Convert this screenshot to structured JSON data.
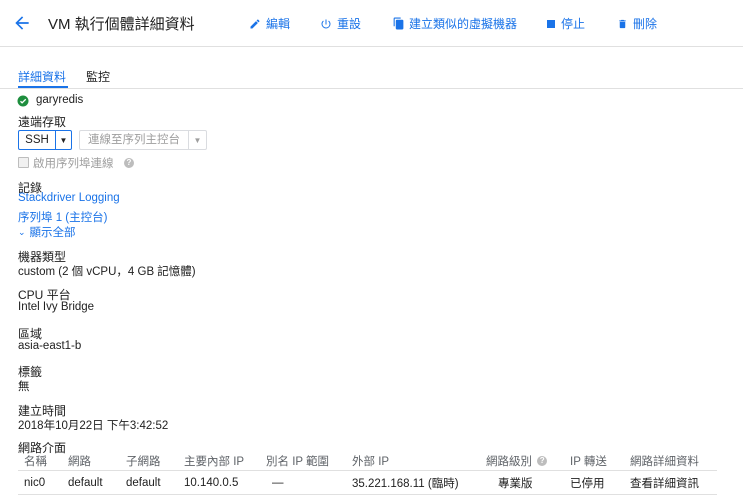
{
  "header": {
    "title": "VM 執行個體詳細資料",
    "actions": [
      {
        "label": "編輯",
        "icon": "pencil-icon"
      },
      {
        "label": "重設",
        "icon": "power-icon"
      },
      {
        "label": "建立類似的虛擬機器",
        "icon": "copy-icon"
      },
      {
        "label": "停止",
        "icon": "stop-icon"
      },
      {
        "label": "刪除",
        "icon": "trash-icon"
      }
    ]
  },
  "tabs": [
    {
      "label": "詳細資料",
      "active": true
    },
    {
      "label": "監控",
      "active": false
    }
  ],
  "instance": {
    "name": "garyredis",
    "status_color": "#1e8e3e"
  },
  "remote": {
    "label": "遠端存取",
    "ssh_label": "SSH",
    "serial_label": "連線至序列主控台",
    "enable_serial_label": "啟用序列埠連線"
  },
  "logs": {
    "label": "記錄",
    "stackdriver": "Stackdriver Logging",
    "serial_port": "序列埠 1 (主控台)",
    "show_all": "顯示全部"
  },
  "machine_type": {
    "label": "機器類型",
    "value": "custom (2 個 vCPU，4 GB 記憶體)"
  },
  "cpu_platform": {
    "label": "CPU 平台",
    "value": "Intel Ivy Bridge"
  },
  "zone": {
    "label": "區域",
    "value": "asia-east1-b"
  },
  "tags": {
    "label": "標籤",
    "value": "無"
  },
  "created": {
    "label": "建立時間",
    "value": "2018年10月22日 下午3:42:52"
  },
  "network": {
    "label": "網路介面",
    "columns": [
      "名稱",
      "網路",
      "子網路",
      "主要內部 IP",
      "別名 IP 範圍",
      "外部 IP",
      "網路級別",
      "IP 轉送",
      "網路詳細資料"
    ],
    "rows": [
      [
        "nic0",
        "default",
        "default",
        "10.140.0.5",
        "—",
        "35.221.168.11 (臨時)",
        "專業版",
        "已停用",
        "查看詳細資訊"
      ]
    ]
  },
  "colors": {
    "accent": "#1a73e8",
    "text": "#212121",
    "muted": "#5f6368"
  }
}
